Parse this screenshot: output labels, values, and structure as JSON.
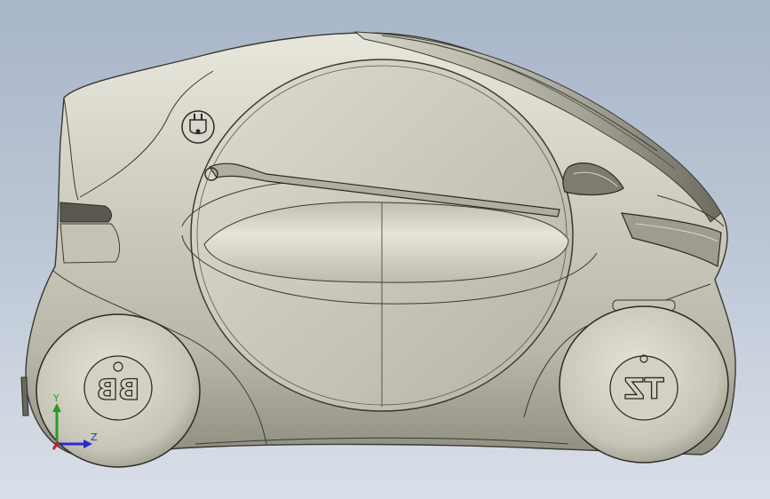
{
  "viewport": {
    "background_top": "#a9b6c9",
    "background_bottom": "#d9dfe8"
  },
  "model": {
    "body_color": "#cfcdbf",
    "edge_color": "#3a3a32",
    "front_hub_text": "BB",
    "rear_hub_text": "TZ"
  },
  "triad": {
    "y_label": "Y",
    "z_label": "Z",
    "y_color": "#2a9a2a",
    "z_color": "#2a2ad0",
    "x_color": "#d02020"
  }
}
